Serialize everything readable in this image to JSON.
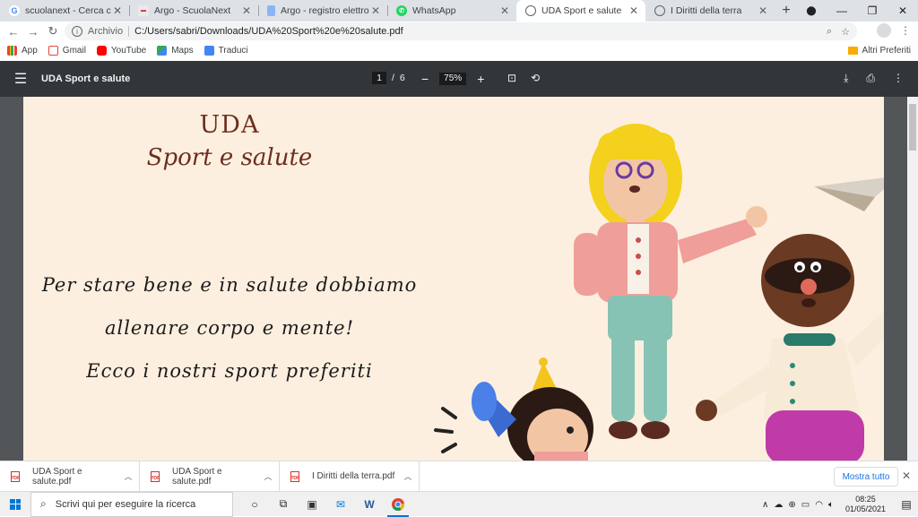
{
  "browser": {
    "tabs": [
      {
        "title": "scuolanext - Cerca con Goo",
        "favicon": "google-icon",
        "active": false
      },
      {
        "title": "Argo - ScuolaNext",
        "favicon": "argo-icon",
        "active": false
      },
      {
        "title": "Argo - registro elettronico",
        "favicon": "argo-doc-icon",
        "active": false
      },
      {
        "title": "WhatsApp",
        "favicon": "whatsapp-icon",
        "active": false
      },
      {
        "title": "UDA Sport e salute",
        "favicon": "globe-icon",
        "active": true
      },
      {
        "title": "I Diritti della terra",
        "favicon": "globe-icon",
        "active": false
      }
    ],
    "new_tab": "+",
    "window_controls": {
      "minimize": "—",
      "maximize": "❐",
      "close": "✕"
    },
    "address": {
      "scheme_label": "Archivio",
      "url": "C:/Users/sabri/Downloads/UDA%20Sport%20e%20salute.pdf"
    },
    "bookmarks": [
      {
        "label": "App",
        "icon": "apps-grid-icon"
      },
      {
        "label": "Gmail",
        "icon": "gmail-icon"
      },
      {
        "label": "YouTube",
        "icon": "youtube-icon"
      },
      {
        "label": "Maps",
        "icon": "maps-icon"
      },
      {
        "label": "Traduci",
        "icon": "translate-icon"
      }
    ],
    "other_bookmarks": "Altri Preferiti"
  },
  "pdf_viewer": {
    "title": "UDA Sport e salute",
    "current_page": "1",
    "page_sep": "/",
    "total_pages": "6",
    "zoom_minus": "−",
    "zoom": "75%",
    "zoom_plus": "+"
  },
  "slide": {
    "title_line1": "UDA",
    "title_line2": "Sport e salute",
    "body_lines": [
      "Per stare bene e in salute dobbiamo",
      "allenare corpo e mente!",
      "Ecco i nostri sport preferiti"
    ]
  },
  "downloads": {
    "items": [
      {
        "name": "UDA Sport e salute.pdf"
      },
      {
        "name": "UDA Sport e salute.pdf"
      },
      {
        "name": "I Diritti della terra.pdf"
      }
    ],
    "show_all": "Mostra tutto",
    "pdf_badge": "PDF"
  },
  "taskbar": {
    "search_placeholder": "Scrivi qui per eseguire la ricerca",
    "time": "08:25",
    "date": "01/05/2021"
  },
  "colors": {
    "page_bg": "#fdefdf",
    "title_color": "#6b2f1f",
    "pdf_toolbar": "#323639",
    "accent_blue": "#1a73e8"
  }
}
